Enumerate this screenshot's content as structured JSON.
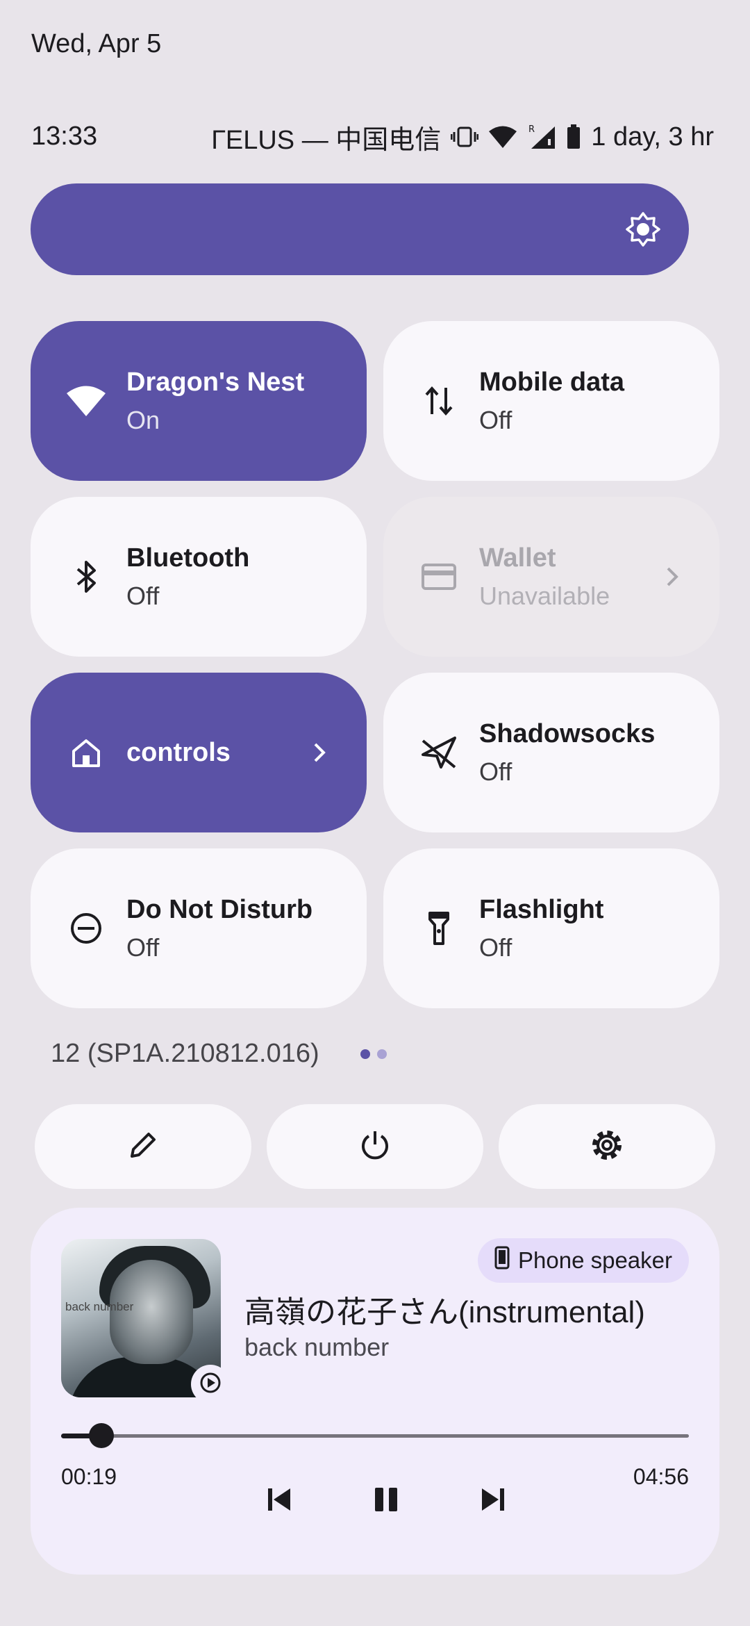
{
  "status": {
    "date": "Wed, Apr 5",
    "time": "13:33",
    "carrier": "ГELUS — 中国电信",
    "battery_text": "1 day, 3 hr",
    "brightness_level": 1.0
  },
  "tiles": [
    {
      "title": "Dragon's Nest",
      "subtitle": "On",
      "icon": "wifi-icon",
      "state": "on"
    },
    {
      "title": "Mobile data",
      "subtitle": "Off",
      "icon": "mobile-data-icon",
      "state": "off"
    },
    {
      "title": "Bluetooth",
      "subtitle": "Off",
      "icon": "bluetooth-icon",
      "state": "off"
    },
    {
      "title": "Wallet",
      "subtitle": "Unavailable",
      "icon": "wallet-icon",
      "state": "unavailable"
    },
    {
      "title": "controls",
      "subtitle": "",
      "icon": "home-icon",
      "state": "on"
    },
    {
      "title": "Shadowsocks",
      "subtitle": "Off",
      "icon": "shadowsocks-icon",
      "state": "off"
    },
    {
      "title": "Do Not Disturb",
      "subtitle": "Off",
      "icon": "do-not-disturb-icon",
      "state": "off"
    },
    {
      "title": "Flashlight",
      "subtitle": "Off",
      "icon": "flashlight-icon",
      "state": "off"
    }
  ],
  "build": "12 (SP1A.210812.016)",
  "pager": {
    "pages": 2,
    "current": 1
  },
  "colors": {
    "accent": "#5b52a6",
    "tile_off": "#f9f7fb",
    "background": "#e8e4ea",
    "media_bg": "#f2edfb"
  },
  "media": {
    "output": "Phone speaker",
    "title": "高嶺の花子さん(instrumental)",
    "artist": "back number",
    "album_text": "back number",
    "elapsed": "00:19",
    "total": "04:56",
    "progress": 0.064
  }
}
